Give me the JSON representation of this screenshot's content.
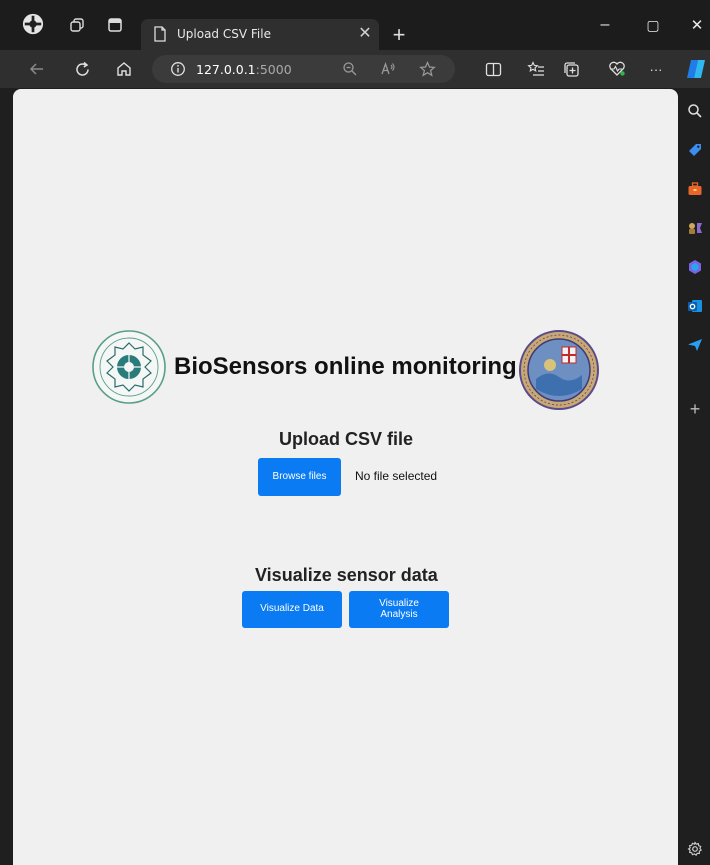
{
  "browser": {
    "tab_title": "Upload CSV File",
    "url_host": "127.0.0.1",
    "url_port": ":5000",
    "tab_close_glyph": "✕",
    "new_tab_glyph": "+",
    "more_glyph": "···",
    "window_controls": {
      "minimize": "–",
      "maximize": "▢",
      "close": "✕"
    },
    "nav_icons": [
      "back-arrow-icon",
      "refresh-icon",
      "home-icon",
      "info-icon"
    ],
    "toolbar_icons": [
      "zoom-out-icon",
      "read-aloud-icon",
      "favorite-star-icon",
      "split-screen-icon",
      "favorites-list-icon",
      "collections-icon",
      "browser-essentials-icon",
      "more-icon",
      "copilot-icon"
    ],
    "sidebar_icons": [
      "search-icon",
      "shopping-tag-icon",
      "tools-icon",
      "games-icon",
      "copilot-app-icon",
      "outlook-icon",
      "send-icon",
      "add-icon",
      "settings-gear-icon"
    ],
    "sidebar_add_glyph": "+"
  },
  "page": {
    "title": "BioSensors online monitoring",
    "upload": {
      "heading": "Upload CSV file",
      "browse_label": "Browse files",
      "status": "No file selected"
    },
    "visualize": {
      "heading": "Visualize sensor data",
      "data_button": "Visualize Data",
      "analysis_button": "Visualize\nAnalysis"
    }
  },
  "colors": {
    "accent_button": "#0a7bf2",
    "page_background": "#f0f0f0",
    "browser_chrome": "#1c1c1c"
  }
}
